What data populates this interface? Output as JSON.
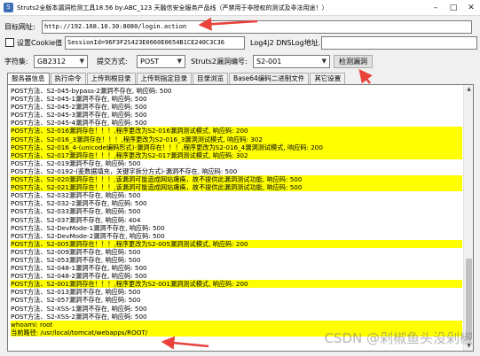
{
  "window": {
    "title": "Struts2全版本漏洞检测工具18.56 by:ABC_123 天融信安全服务产品线（严禁用于非授权的测试及非法用途！）",
    "icon": "app-icon"
  },
  "url_row": {
    "label": "目标网址:",
    "value": "http://192.168.10.30:8080/login.action"
  },
  "cookie_row": {
    "checkbox_label": "设置Cookie值",
    "cookie_value": "SessionId=96F3F2S423E0660E0654B1CE240C3C36",
    "dnslog_button": "Log4j2 DNSLog地址...",
    "dnslog_value": ""
  },
  "options_row": {
    "charset_label": "字符集:",
    "charset_value": "GB2312",
    "method_label": "提交方式:",
    "method_value": "POST",
    "vuln_label": "Struts2漏洞编号:",
    "vuln_value": "S2-001",
    "check_button": "检测漏洞"
  },
  "tabs": [
    "服务器信息",
    "执行命令",
    "上传到根目录",
    "上传到指定目录",
    "目录浏览",
    "Base64编码二进制文件",
    "其它设置"
  ],
  "active_tab": 0,
  "log_lines": [
    {
      "text": "POST方法、S2-045-bypass-2漏洞不存在, 响应码: 500",
      "hl": false
    },
    {
      "text": "POST方法、S2-045-1漏洞不存在, 响应码: 500",
      "hl": false
    },
    {
      "text": "POST方法、S2-045-2漏洞不存在, 响应码: 500",
      "hl": false
    },
    {
      "text": "POST方法、S2-045-3漏洞不存在, 响应码: 500",
      "hl": false
    },
    {
      "text": "POST方法、S2-045-4漏洞不存在, 响应码: 500",
      "hl": false
    },
    {
      "text": "POST方法、S2-016漏洞存在！！！,程序更改为S2-016漏洞测试模式, 响应码: 200",
      "hl": true
    },
    {
      "text": "POST方法、S2-016_3漏洞存在！！！,程序更改为S2-016_3漏洞测试模式, 响应码: 302",
      "hl": true
    },
    {
      "text": "POST方法、S2-016_4-(unicode编码形式)-漏洞存在！！！,程序更改为S2-016_4漏洞测试模式, 响应码: 200",
      "hl": true
    },
    {
      "text": "POST方法、S2-017漏洞存在！！！,程序更改为S2-017漏洞测试模式, 响应码: 302",
      "hl": true
    },
    {
      "text": "POST方法、S2-019漏洞不存在, 响应码: 500",
      "hl": false
    },
    {
      "text": "POST方法、S2-0192-(鉴数据填充，关键字拆分方式)-漏洞不存在, 响应码: 500",
      "hl": false
    },
    {
      "text": "POST方法、S2-020漏洞存在！！！,该漏洞可能造成网站瘫痪，故不提供此漏洞测试功能, 响应码: 500",
      "hl": true
    },
    {
      "text": "POST方法、S2-021漏洞存在！！！,该漏洞可能造成网站瘫痪，故不提供此漏洞测试功能, 响应码: 500",
      "hl": true
    },
    {
      "text": "POST方法、S2-032漏洞不存在, 响应码: 500",
      "hl": false
    },
    {
      "text": "POST方法、S2-032-2漏洞不存在, 响应码: 500",
      "hl": false
    },
    {
      "text": "POST方法、S2-033漏洞不存在, 响应码: 500",
      "hl": false
    },
    {
      "text": "POST方法、S2-037漏洞不存在, 响应码: 404",
      "hl": false
    },
    {
      "text": "POST方法、S2-DevMode-1漏洞不存在, 响应码: 500",
      "hl": false
    },
    {
      "text": "POST方法、S2-DevMode-2漏洞不存在, 响应码: 500",
      "hl": false
    },
    {
      "text": "POST方法、S2-005漏洞存在！！！,程序更改为S2-005漏洞测试模式, 响应码: 200",
      "hl": true
    },
    {
      "text": "POST方法、S2-009漏洞不存在, 响应码: 500",
      "hl": false
    },
    {
      "text": "POST方法、S2-053漏洞不存在, 响应码: 500",
      "hl": false
    },
    {
      "text": "POST方法、S2-048-1漏洞不存在, 响应码: 500",
      "hl": false
    },
    {
      "text": "POST方法、S2-048-2漏洞不存在, 响应码: 500",
      "hl": false
    },
    {
      "text": "POST方法、S2-001漏洞存在！！！,程序更改为S2-001漏洞测试模式, 响应码: 200",
      "hl": true
    },
    {
      "text": "POST方法、S2-013漏洞不存在, 响应码: 500",
      "hl": false
    },
    {
      "text": "POST方法、S2-057漏洞不存在, 响应码: 500",
      "hl": false
    },
    {
      "text": "POST方法、S2-XSS-1漏洞不存在, 响应码: 500",
      "hl": false
    },
    {
      "text": "POST方法、S2-XSS-2漏洞不存在, 响应码: 500",
      "hl": false
    },
    {
      "text": "whoami:   root",
      "hl": true
    },
    {
      "text": "当前路径:  /usr/local/tomcat/webapps/ROOT/",
      "hl": true
    }
  ],
  "watermark": "CSDN @剁椒鱼头没剁椒",
  "colors": {
    "highlight": "#ffff00",
    "annotation_arrow": "#e8423a"
  }
}
